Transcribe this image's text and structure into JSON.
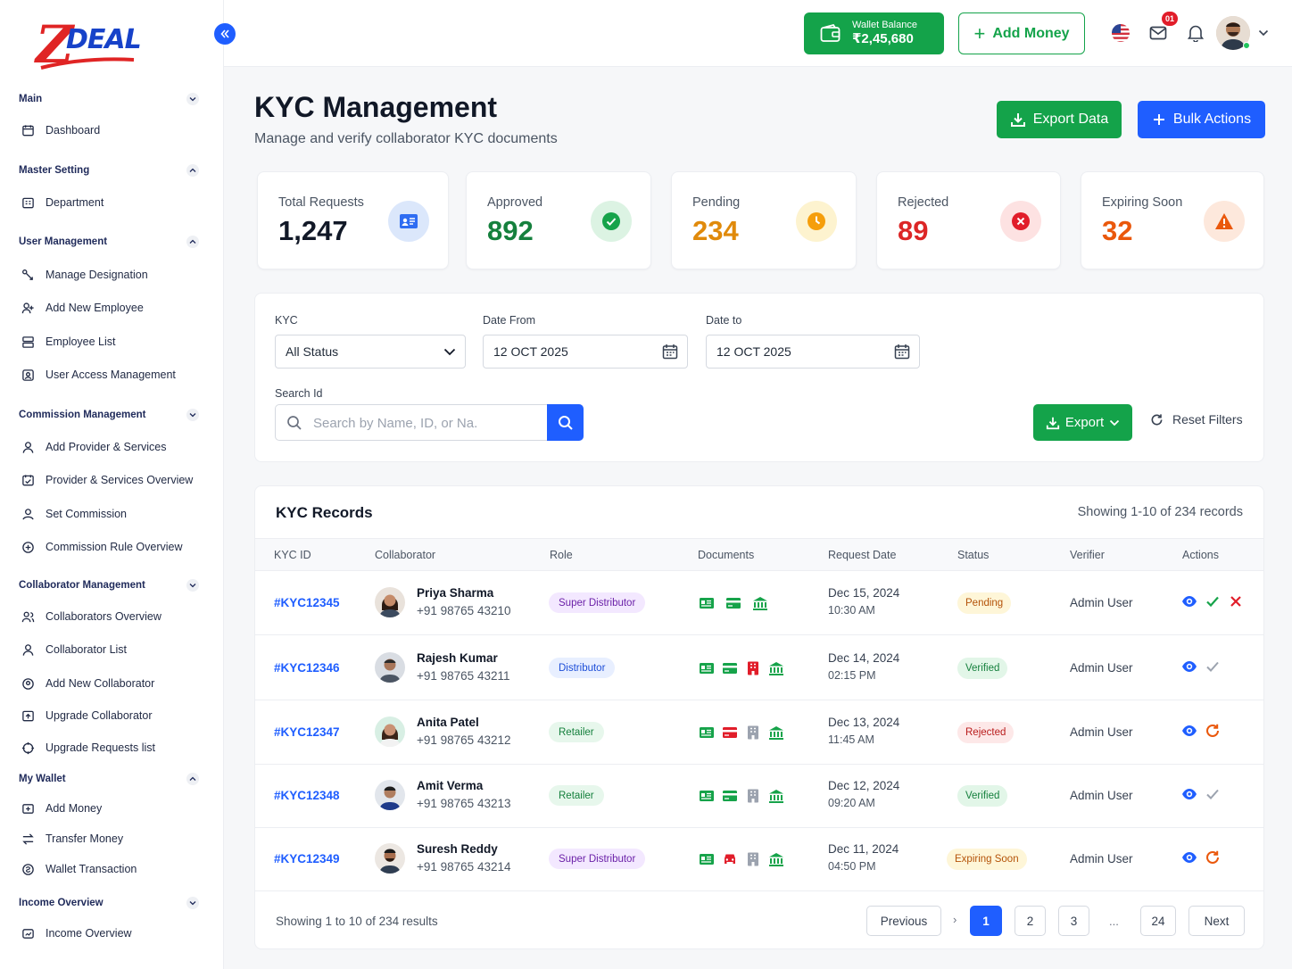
{
  "brand": {
    "logo_z": "Z",
    "logo_text": "DEAL"
  },
  "sidebar": {
    "sections": [
      {
        "label": "Main",
        "items": [
          "Dashboard"
        ]
      },
      {
        "label": "Master Setting",
        "items": [
          "Department"
        ]
      },
      {
        "label": "User Management",
        "items": [
          "Manage Designation",
          "Add New Employee",
          "Employee List",
          "User Access Management"
        ]
      },
      {
        "label": "Commission Management",
        "items": [
          "Add Provider & Services",
          "Provider & Services Overview",
          "Set Commission",
          "Commission Rule Overview"
        ]
      },
      {
        "label": "Collaborator Management",
        "items": [
          "Collaborators Overview",
          "Collaborator List",
          "Add New Collaborator",
          "Upgrade Collaborator",
          "Upgrade Requests list"
        ]
      },
      {
        "label": "My Wallet",
        "items": [
          "Add Money",
          "Transfer Money",
          "Wallet Transaction"
        ]
      },
      {
        "label": "Income Overview",
        "items": [
          "Income Overview"
        ]
      }
    ]
  },
  "topbar": {
    "wallet_label": "Wallet Balance",
    "wallet_value": "₹2,45,680",
    "add_money": "Add Money",
    "notification_badge": "01"
  },
  "header": {
    "title": "KYC Management",
    "subtitle": "Manage and verify collaborator KYC documents",
    "export_data": "Export Data",
    "bulk_actions": "Bulk Actions"
  },
  "stats": [
    {
      "label": "Total Requests",
      "value": "1,247",
      "color": "#111827",
      "icon": "id-card-icon"
    },
    {
      "label": "Approved",
      "value": "892",
      "color": "#15803d",
      "icon": "check-circle-icon"
    },
    {
      "label": "Pending",
      "value": "234",
      "color": "#e08a0b",
      "icon": "clock-icon"
    },
    {
      "label": "Rejected",
      "value": "89",
      "color": "#dc2626",
      "icon": "x-circle-icon"
    },
    {
      "label": "Expiring Soon",
      "value": "32",
      "color": "#ea580c",
      "icon": "warning-icon"
    }
  ],
  "filters": {
    "kyc_label": "KYC",
    "kyc_value": "All Status",
    "date_from_label": "Date From",
    "date_from_value": "12 OCT 2025",
    "date_to_label": "Date to",
    "date_to_value": "12 OCT 2025",
    "search_label": "Search Id",
    "search_placeholder": "Search by Name, ID, or Na.",
    "export": "Export",
    "reset": "Reset Filters"
  },
  "records": {
    "title": "KYC Records",
    "count": "Showing 1-10 of 234 records",
    "columns": [
      "KYC ID",
      "Collaborator",
      "Role",
      "Documents",
      "Request Date",
      "Status",
      "Verifier",
      "Actions"
    ],
    "rows": [
      {
        "id": "#KYC12345",
        "name": "Priya Sharma",
        "phone": "+91 98765 43210",
        "role": "Super Distributor",
        "date": "Dec 15, 2024",
        "time": "10:30 AM",
        "status": "Pending",
        "verifier": "Admin User"
      },
      {
        "id": "#KYC12346",
        "name": "Rajesh Kumar",
        "phone": "+91 98765 43211",
        "role": "Distributor",
        "date": "Dec 14, 2024",
        "time": "02:15 PM",
        "status": "Verified",
        "verifier": "Admin User"
      },
      {
        "id": "#KYC12347",
        "name": "Anita Patel",
        "phone": "+91 98765 43212",
        "role": "Retailer",
        "date": "Dec 13, 2024",
        "time": "11:45 AM",
        "status": "Rejected",
        "verifier": "Admin User"
      },
      {
        "id": "#KYC12348",
        "name": "Amit Verma",
        "phone": "+91 98765 43213",
        "role": "Retailer",
        "date": "Dec 12, 2024",
        "time": "09:20 AM",
        "status": "Verified",
        "verifier": "Admin User"
      },
      {
        "id": "#KYC12349",
        "name": "Suresh Reddy",
        "phone": "+91 98765 43214",
        "role": "Super Distributor",
        "date": "Dec 11, 2024",
        "time": "04:50 PM",
        "status": "Expiring Soon",
        "verifier": "Admin User"
      }
    ],
    "footer": "Showing 1 to 10 of 234 results",
    "pagination": {
      "previous": "Previous",
      "gt": "›",
      "pages": [
        "1",
        "2",
        "3"
      ],
      "dots": "...",
      "last": "24",
      "next": "Next"
    }
  },
  "colors": {
    "primary": "#1f5eff",
    "success": "#14a34a",
    "danger": "#dc2626",
    "warning": "#e08a0b"
  }
}
